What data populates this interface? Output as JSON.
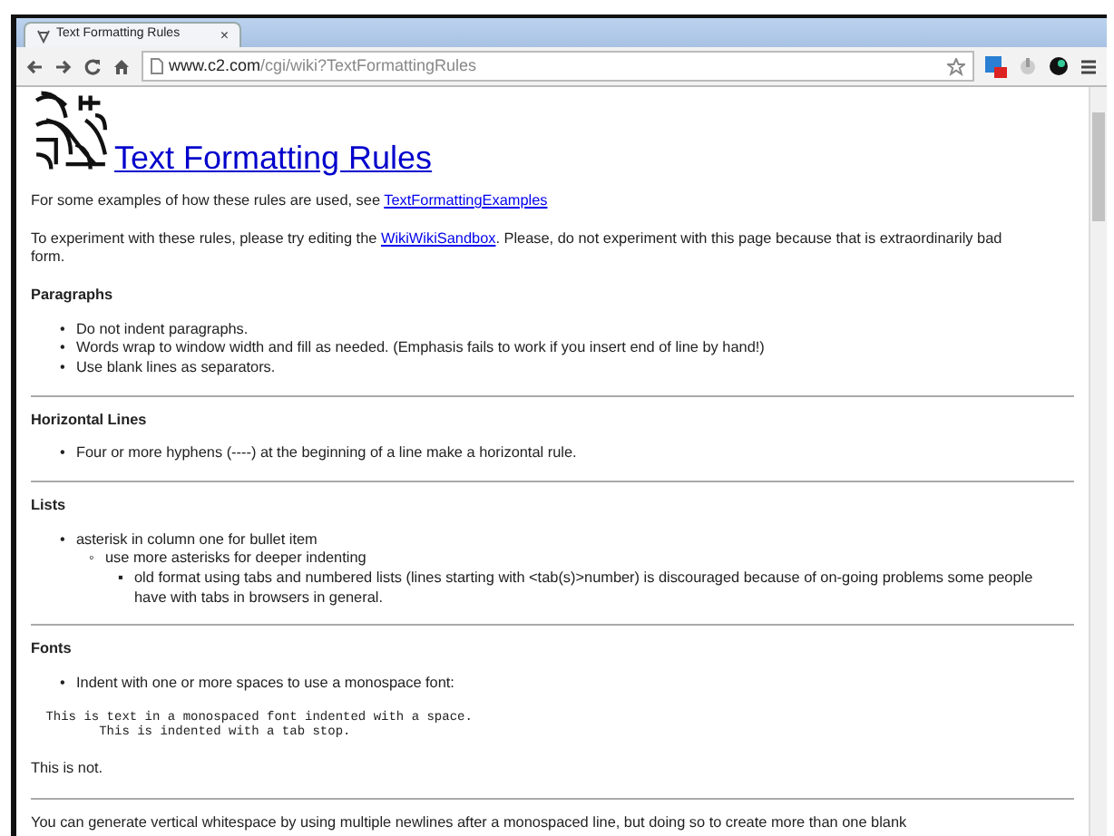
{
  "browser": {
    "tab": {
      "title": "Text Formatting Rules",
      "close": "×"
    },
    "url": {
      "host": "www.c2.com",
      "path": "/cgi/wiki?TextFormattingRules"
    }
  },
  "page": {
    "title": "Text Formatting Rules",
    "blocks": [
      {
        "kind": "paragraph",
        "parts": [
          {
            "kind": "text",
            "text": "For some examples of how these rules are used, see "
          },
          {
            "kind": "link",
            "text": "TextFormattingExamples"
          }
        ]
      },
      {
        "kind": "paragraph",
        "parts": [
          {
            "kind": "text",
            "text": "To experiment with these rules, please try editing the "
          },
          {
            "kind": "link",
            "text": "WikiWikiSandbox"
          },
          {
            "kind": "text",
            "text": ". Please, do not experiment with this page because that is extraordinarily bad form."
          }
        ]
      },
      {
        "kind": "heading",
        "text": "Paragraphs"
      },
      {
        "kind": "list",
        "items": [
          {
            "marker": "•",
            "text": "Do not indent paragraphs."
          },
          {
            "marker": "•",
            "text": "Words wrap to window width and fill as needed. (Emphasis fails to work if you insert end of line by hand!)"
          },
          {
            "marker": "•",
            "text": "Use blank lines as separators."
          }
        ]
      },
      {
        "kind": "rule"
      },
      {
        "kind": "heading",
        "text": "Horizontal Lines"
      },
      {
        "kind": "list",
        "items": [
          {
            "marker": "•",
            "text": "Four or more hyphens (----) at the beginning of a line make a horizontal rule."
          }
        ]
      },
      {
        "kind": "rule"
      },
      {
        "kind": "heading",
        "text": "Lists"
      },
      {
        "kind": "list",
        "items": [
          {
            "marker": "•",
            "text": "asterisk in column one for bullet item",
            "children": [
              {
                "marker": "◦",
                "text": "use more asterisks for deeper indenting",
                "children": [
                  {
                    "marker": "▪",
                    "text": "old format using tabs and numbered lists (lines starting with <tab(s)>number) is discouraged because of on-going problems some people have with tabs in browsers in general."
                  }
                ]
              }
            ]
          }
        ]
      },
      {
        "kind": "rule"
      },
      {
        "kind": "heading",
        "text": "Fonts"
      },
      {
        "kind": "list",
        "items": [
          {
            "marker": "•",
            "text": "Indent with one or more spaces to use a monospace font:"
          }
        ]
      },
      {
        "kind": "pre",
        "lines": [
          " This is text in a monospaced font indented with a space.",
          "        This is indented with a tab stop."
        ]
      },
      {
        "kind": "paragraph",
        "parts": [
          {
            "kind": "text",
            "text": "This is not."
          }
        ]
      },
      {
        "kind": "rule"
      },
      {
        "kind": "paragraph",
        "parts": [
          {
            "kind": "text",
            "text": "You can generate vertical whitespace by using multiple newlines after a monospaced line, but doing so to create more than one blank"
          }
        ]
      }
    ]
  }
}
